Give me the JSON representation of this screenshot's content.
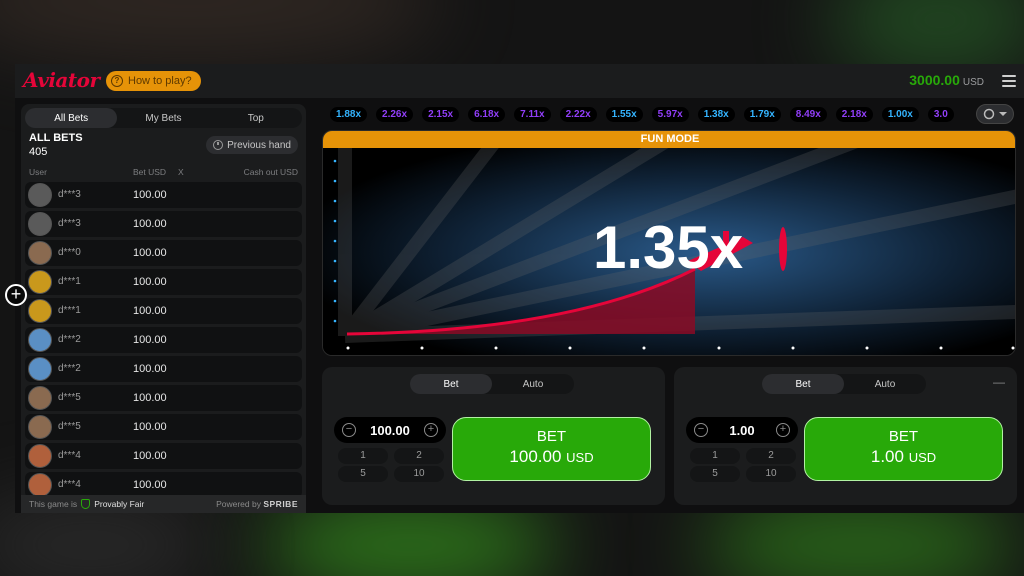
{
  "header": {
    "logo": "Aviator",
    "how_to_play": "How to play?",
    "balance": "3000.00",
    "currency": "USD"
  },
  "bets_panel": {
    "tabs": [
      "All Bets",
      "My Bets",
      "Top"
    ],
    "title": "ALL BETS",
    "count": "405",
    "previous_hand": "Previous hand",
    "columns": {
      "user": "User",
      "bet": "Bet USD",
      "x": "X",
      "cashout": "Cash out USD"
    },
    "rows": [
      {
        "user": "d***3",
        "bet": "100.00",
        "avatar_color": "#5a5a5a"
      },
      {
        "user": "d***3",
        "bet": "100.00",
        "avatar_color": "#5a5a5a"
      },
      {
        "user": "d***0",
        "bet": "100.00",
        "avatar_color": "#8a6a50"
      },
      {
        "user": "d***1",
        "bet": "100.00",
        "avatar_color": "#c9981c"
      },
      {
        "user": "d***1",
        "bet": "100.00",
        "avatar_color": "#c9981c"
      },
      {
        "user": "d***2",
        "bet": "100.00",
        "avatar_color": "#5a8fc4"
      },
      {
        "user": "d***2",
        "bet": "100.00",
        "avatar_color": "#5a8fc4"
      },
      {
        "user": "d***5",
        "bet": "100.00",
        "avatar_color": "#8a6a50"
      },
      {
        "user": "d***5",
        "bet": "100.00",
        "avatar_color": "#8a6a50"
      },
      {
        "user": "d***4",
        "bet": "100.00",
        "avatar_color": "#b0603c"
      },
      {
        "user": "d***4",
        "bet": "100.00",
        "avatar_color": "#b0603c"
      }
    ],
    "footer": {
      "text": "This game is",
      "provably_fair": "Provably Fair",
      "powered_by": "Powered by",
      "brand": "SPRIBE"
    }
  },
  "history": [
    {
      "value": "1.88x",
      "color": "#34b4ff"
    },
    {
      "value": "2.26x",
      "color": "#913ef8"
    },
    {
      "value": "2.15x",
      "color": "#913ef8"
    },
    {
      "value": "6.18x",
      "color": "#913ef8"
    },
    {
      "value": "7.11x",
      "color": "#913ef8"
    },
    {
      "value": "2.22x",
      "color": "#913ef8"
    },
    {
      "value": "1.55x",
      "color": "#34b4ff"
    },
    {
      "value": "5.97x",
      "color": "#913ef8"
    },
    {
      "value": "1.38x",
      "color": "#34b4ff"
    },
    {
      "value": "1.79x",
      "color": "#34b4ff"
    },
    {
      "value": "8.49x",
      "color": "#913ef8"
    },
    {
      "value": "2.18x",
      "color": "#913ef8"
    },
    {
      "value": "1.00x",
      "color": "#34b4ff"
    },
    {
      "value": "3.0",
      "color": "#913ef8"
    }
  ],
  "game": {
    "mode": "FUN MODE",
    "multiplier": "1.35x",
    "accent": "#e50539"
  },
  "bet_panels": [
    {
      "tabs": [
        "Bet",
        "Auto"
      ],
      "amount": "100.00",
      "quick": [
        "1",
        "2",
        "5",
        "10"
      ],
      "button_title": "BET",
      "button_amount": "100.00",
      "button_currency": "USD"
    },
    {
      "tabs": [
        "Bet",
        "Auto"
      ],
      "amount": "1.00",
      "quick": [
        "1",
        "2",
        "5",
        "10"
      ],
      "button_title": "BET",
      "button_amount": "1.00",
      "button_currency": "USD",
      "extra": "—"
    }
  ]
}
